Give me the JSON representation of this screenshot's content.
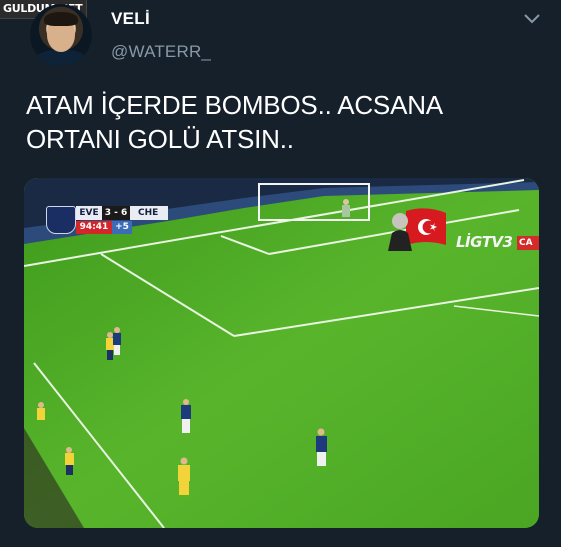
{
  "watermark": "GULDUM.NET",
  "tweet": {
    "display_name": "VELİ",
    "handle": "@WATERR_",
    "text": "ATAM İÇERDE BOMBOS.. ACSANA\nORTANI GOLÜ ATSIN.."
  },
  "icons": {
    "menu": "chevron-down-icon",
    "avatar": "profile-avatar"
  },
  "media": {
    "scoreboard": {
      "home": "EVE",
      "score": "3 - 6",
      "away": "CHE",
      "clock": "94:41",
      "added_time": "+5"
    },
    "channel": "LİGTV3",
    "channel_extra": "CA"
  },
  "colors": {
    "background": "#15202b",
    "text": "#ffffff",
    "secondary_text": "#8899a6",
    "pitch": "#4aa623"
  }
}
